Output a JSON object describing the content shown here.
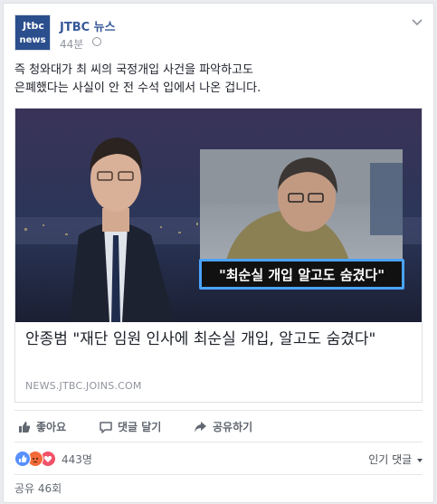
{
  "header": {
    "page_name": "JTBC 뉴스",
    "time": "44분",
    "avatar_top": "Jtbc",
    "avatar_bottom": "news"
  },
  "post": {
    "line1": "즉 청와대가 최 씨의 국정개입 사건을 파악하고도",
    "line2": "은폐했다는 사실이 안 전 수석 입에서 나온 겁니다."
  },
  "share": {
    "image_caption": "\"최순실 개입 알고도 숨겼다\"",
    "title": "안종범 \"재단 임원 인사에 최순실 개입, 알고도 숨겼다\"",
    "domain": "NEWS.JTBC.JOINS.COM"
  },
  "actions": {
    "like": "좋아요",
    "comment": "댓글 달기",
    "share": "공유하기"
  },
  "reactions": {
    "count": "443명",
    "sort": "인기 댓글"
  },
  "shares": "공유 46회",
  "colors": {
    "link": "#365899",
    "like_blue": "#5890ff",
    "angry": "#f26a3a",
    "love": "#f25268",
    "caption_border": "#4aa3ff"
  }
}
